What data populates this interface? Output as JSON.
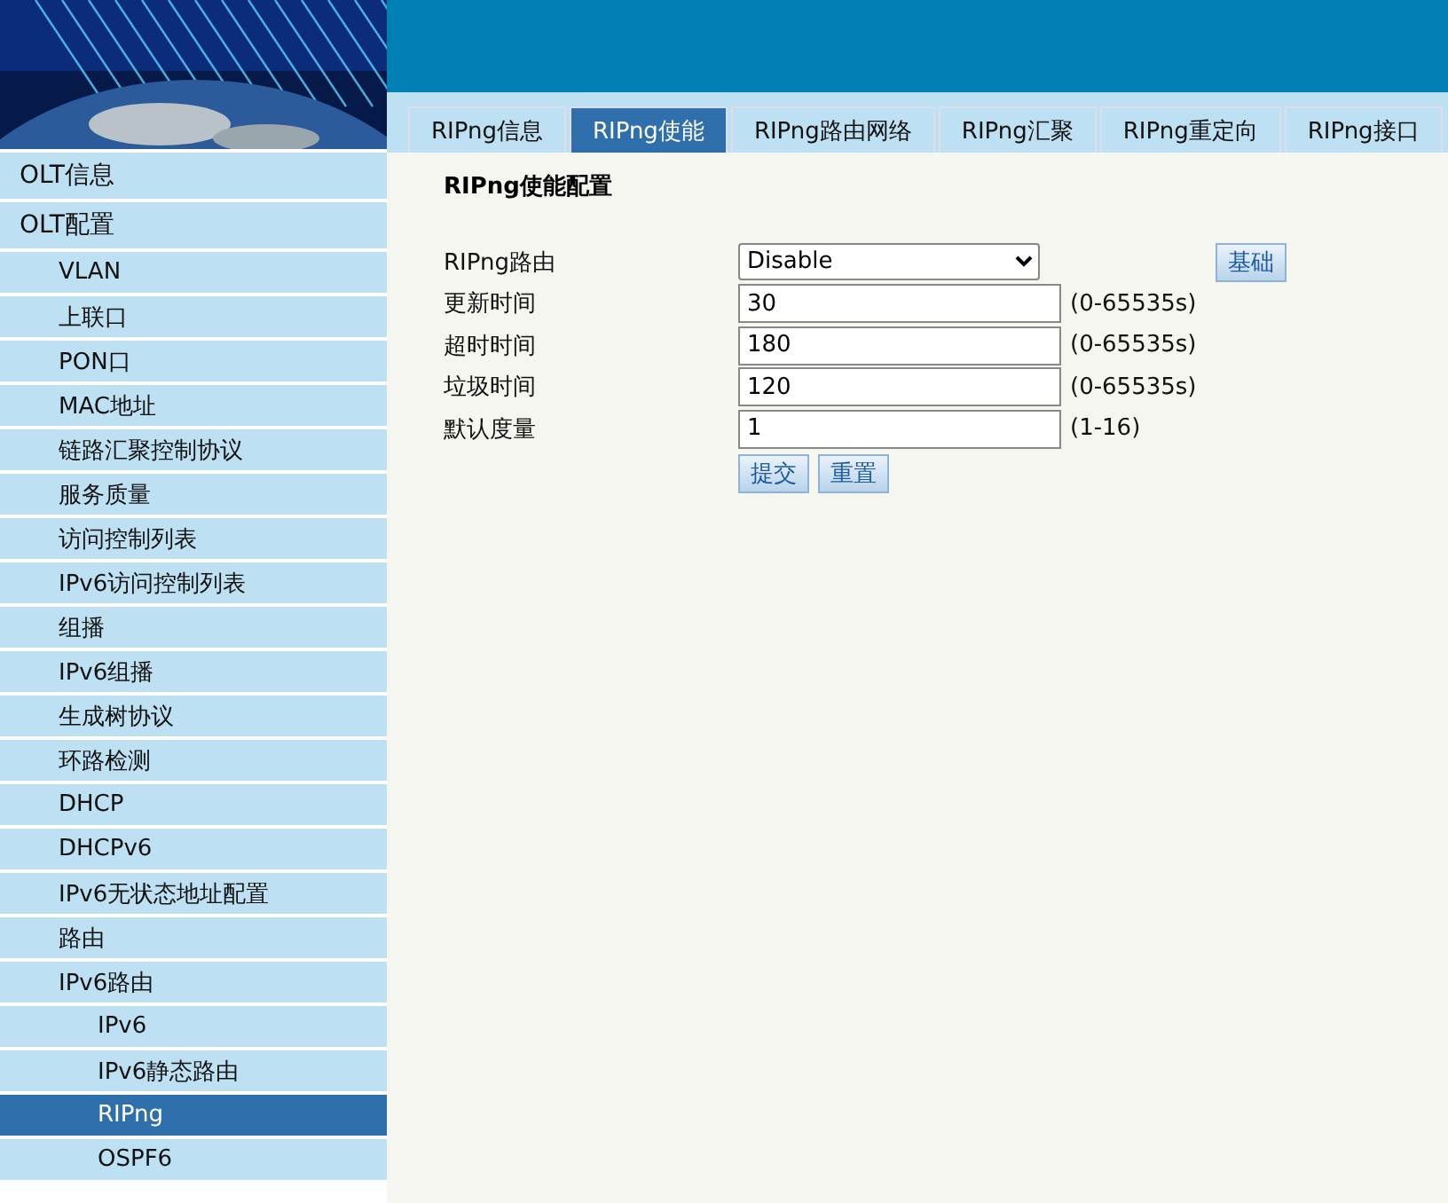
{
  "sidebar": {
    "items": [
      {
        "label": "OLT信息",
        "selected": false
      },
      {
        "label": "OLT配置",
        "selected": false,
        "children": [
          {
            "label": "VLAN",
            "selected": false
          },
          {
            "label": "上联口",
            "selected": false
          },
          {
            "label": "PON口",
            "selected": false
          },
          {
            "label": "MAC地址",
            "selected": false
          },
          {
            "label": "链路汇聚控制协议",
            "selected": false
          },
          {
            "label": "服务质量",
            "selected": false
          },
          {
            "label": "访问控制列表",
            "selected": false
          },
          {
            "label": "IPv6访问控制列表",
            "selected": false
          },
          {
            "label": "组播",
            "selected": false
          },
          {
            "label": "IPv6组播",
            "selected": false
          },
          {
            "label": "生成树协议",
            "selected": false
          },
          {
            "label": "环路检测",
            "selected": false
          },
          {
            "label": "DHCP",
            "selected": false
          },
          {
            "label": "DHCPv6",
            "selected": false
          },
          {
            "label": "IPv6无状态地址配置",
            "selected": false
          },
          {
            "label": "路由",
            "selected": false
          },
          {
            "label": "IPv6路由",
            "selected": false,
            "children": [
              {
                "label": "IPv6",
                "selected": false
              },
              {
                "label": "IPv6静态路由",
                "selected": false
              },
              {
                "label": "RIPng",
                "selected": true
              },
              {
                "label": "OSPF6",
                "selected": false
              }
            ]
          }
        ]
      }
    ]
  },
  "tabs": [
    {
      "label": "RIPng信息",
      "selected": false
    },
    {
      "label": "RIPng使能",
      "selected": true
    },
    {
      "label": "RIPng路由网络",
      "selected": false
    },
    {
      "label": "RIPng汇聚",
      "selected": false
    },
    {
      "label": "RIPng重定向",
      "selected": false
    },
    {
      "label": "RIPng接口",
      "selected": false
    }
  ],
  "form": {
    "title": "RIPng使能配置",
    "fields": [
      {
        "kind": "select",
        "label": "RIPng路由",
        "value": "Disable",
        "button": "基础"
      },
      {
        "kind": "input",
        "label": "更新时间",
        "value": "30",
        "hint": "(0-65535s)"
      },
      {
        "kind": "input",
        "label": "超时时间",
        "value": "180",
        "hint": "(0-65535s)"
      },
      {
        "kind": "input",
        "label": "垃圾时间",
        "value": "120",
        "hint": "(0-65535s)"
      },
      {
        "kind": "input",
        "label": "默认度量",
        "value": "1",
        "hint": "(1-16)"
      }
    ],
    "buttons": [
      "提交",
      "重置"
    ]
  }
}
